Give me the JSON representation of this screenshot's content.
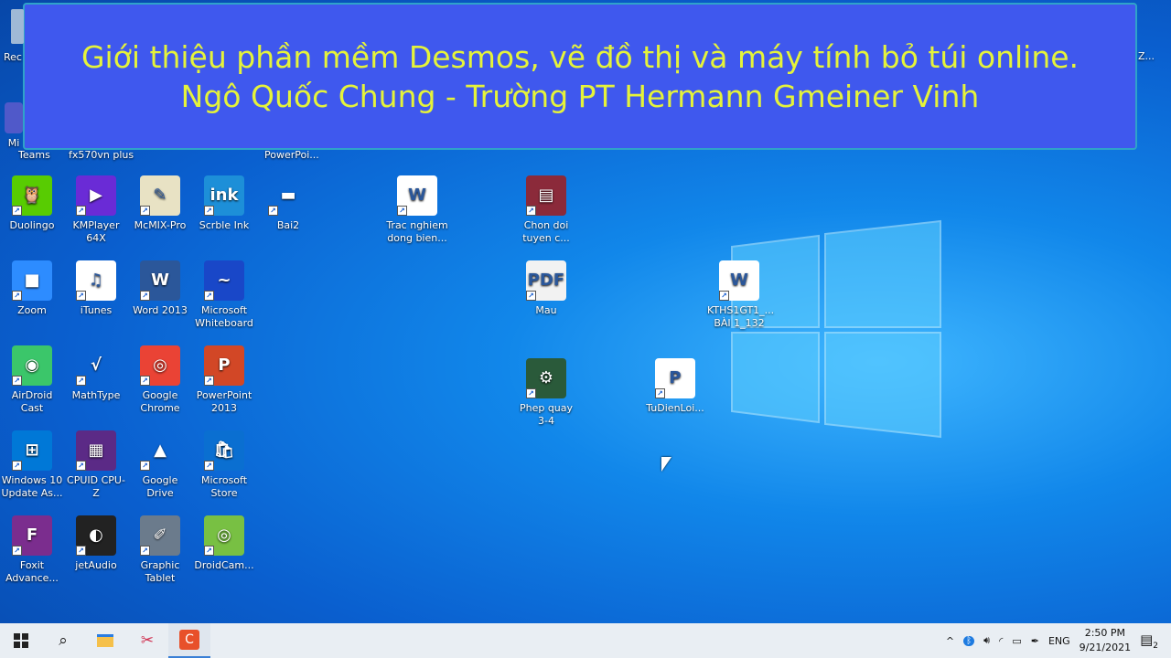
{
  "banner": {
    "line1": "Giới thiệu phần mềm Desmos, vẽ đồ thị và máy tính bỏ túi online.",
    "line2": "Ngô Quốc Chung - Trường PT Hermann Gmeiner Vinh"
  },
  "partial_labels": {
    "recycle": "Rec",
    "teams_1": "Mi",
    "teams_2": "Teams",
    "casio": "fx570vn plus",
    "powerpoint_top": "PowerPoi...",
    "right_edge": "Z..."
  },
  "icons": [
    {
      "label": "Duolingo",
      "color": "#58cc02",
      "glyph": "🦉"
    },
    {
      "label": "KMPlayer 64X",
      "color": "#6a2bd6",
      "glyph": "▶"
    },
    {
      "label": "McMIX-Pro",
      "color": "#e8e2c4",
      "glyph": "✎"
    },
    {
      "label": "Scrble Ink",
      "color": "#1d8fd8",
      "glyph": "ink"
    },
    {
      "label": "Bai2",
      "color": "transparent",
      "glyph": "▬"
    },
    {
      "label": "Zoom",
      "color": "#2d8cff",
      "glyph": "■"
    },
    {
      "label": "iTunes",
      "color": "#ffffff",
      "glyph": "♫"
    },
    {
      "label": "Word 2013",
      "color": "#2b579a",
      "glyph": "W"
    },
    {
      "label": "Microsoft Whiteboard",
      "color": "#1947c8",
      "glyph": "~"
    },
    {
      "label": "AirDroid Cast",
      "color": "#3bc66a",
      "glyph": "◉"
    },
    {
      "label": "MathType",
      "color": "transparent",
      "glyph": "√"
    },
    {
      "label": "Google Chrome",
      "color": "#ea4335",
      "glyph": "◎"
    },
    {
      "label": "PowerPoint 2013",
      "color": "#d24726",
      "glyph": "P"
    },
    {
      "label": "Windows 10 Update As...",
      "color": "#0078d7",
      "glyph": "⊞"
    },
    {
      "label": "CPUID CPU-Z",
      "color": "#5b2a86",
      "glyph": "▦"
    },
    {
      "label": "Google Drive",
      "color": "transparent",
      "glyph": "▲"
    },
    {
      "label": "Microsoft Store",
      "color": "#0a6fd1",
      "glyph": "🛍"
    },
    {
      "label": "Foxit Advance...",
      "color": "#7b2d8e",
      "glyph": "F"
    },
    {
      "label": "jetAudio",
      "color": "#222222",
      "glyph": "◐"
    },
    {
      "label": "Graphic Tablet",
      "color": "#6b7b8c",
      "glyph": "✐"
    },
    {
      "label": "DroidCam...",
      "color": "#78c043",
      "glyph": "◎"
    },
    {
      "label": "Trac nghiem dong bien...",
      "color": "#ffffff",
      "glyph": "W"
    },
    {
      "label": "Chon doi tuyen c...",
      "color": "#8b2a3a",
      "glyph": "▤"
    },
    {
      "label": "Mau",
      "color": "#f2f2f2",
      "glyph": "PDF"
    },
    {
      "label": "Phep quay 3-4",
      "color": "#2a5a3a",
      "glyph": "⚙"
    },
    {
      "label": "TuDienLoi...",
      "color": "#ffffff",
      "glyph": "P"
    },
    {
      "label": "KTHS1GT1_... BÀI 1_132",
      "color": "#ffffff",
      "glyph": "W"
    }
  ],
  "taskbar": {
    "apps": [
      "start",
      "search",
      "file-explorer",
      "snipping",
      "camtasia"
    ],
    "language": "ENG",
    "time": "2:50 PM",
    "date": "9/21/2021",
    "notifications": "2"
  }
}
